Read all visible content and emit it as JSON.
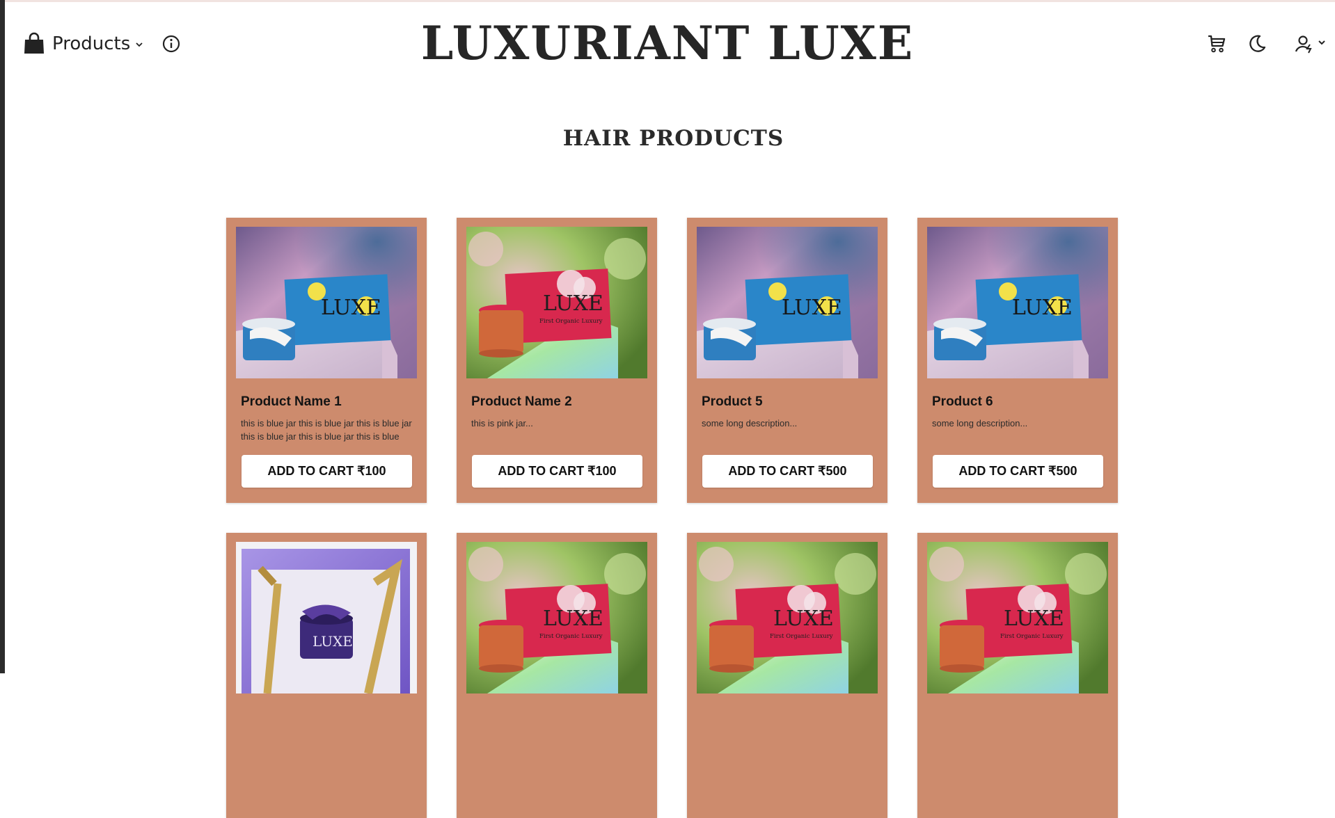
{
  "header": {
    "products_label": "Products",
    "brand": "LUXURIANT LUXE",
    "icons": [
      "shopping-bag-icon",
      "chevron-down-icon",
      "info-icon",
      "cart-icon",
      "moon-icon",
      "user-icon"
    ]
  },
  "page": {
    "title": "HAIR PRODUCTS"
  },
  "colors": {
    "card_bg": "#cd8b6d",
    "button_bg": "#ffffff",
    "brand_text": "#262626"
  },
  "products": [
    {
      "name": "Product Name 1",
      "description": "this is blue jar this is blue jar this is blue jar this is blue jar this is blue jar this is blue ja...",
      "button": "ADD TO CART ₹100",
      "image_theme": "blue-box-purple-sky"
    },
    {
      "name": "Product Name 2",
      "description": "this is pink jar...",
      "button": "ADD TO CART ₹100",
      "image_theme": "pink-box-green-bokeh"
    },
    {
      "name": "Product 5",
      "description": "some long description...",
      "button": "ADD TO CART ₹500",
      "image_theme": "blue-box-purple-sky"
    },
    {
      "name": "Product 6",
      "description": "some long description...",
      "button": "ADD TO CART ₹500",
      "image_theme": "blue-box-purple-sky"
    },
    {
      "image_theme": "purple-gift-box"
    },
    {
      "image_theme": "pink-box-green-bokeh"
    },
    {
      "image_theme": "pink-box-green-bokeh"
    },
    {
      "image_theme": "pink-box-green-bokeh"
    }
  ],
  "image_text": {
    "logo": "LUXE",
    "tagline": "First Organic Luxury"
  }
}
